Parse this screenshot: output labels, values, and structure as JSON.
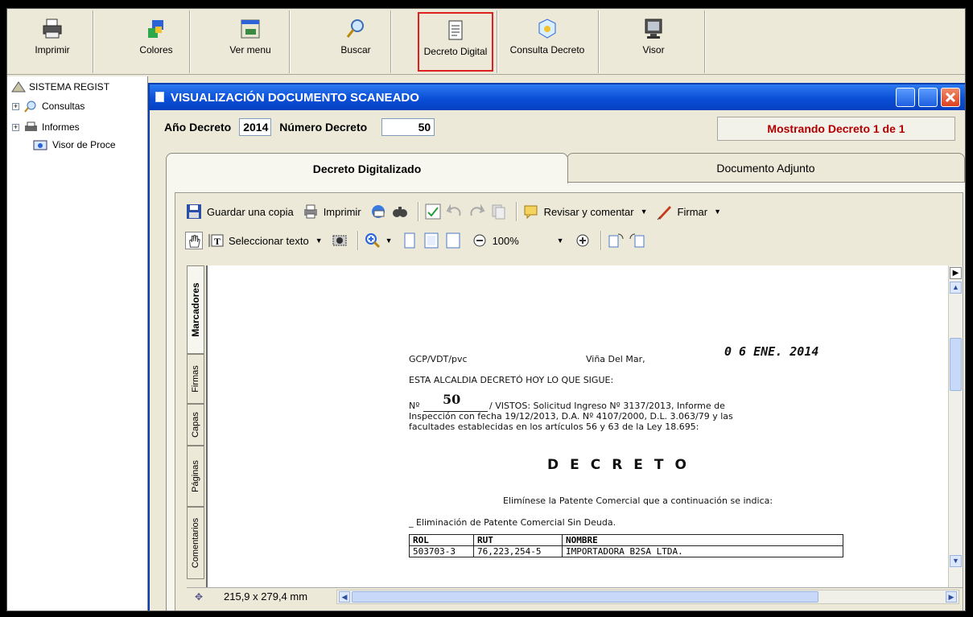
{
  "toolbar": {
    "items": [
      {
        "label": "Imprimir",
        "icon": "printer-icon"
      },
      {
        "label": "Colores",
        "icon": "colors-icon"
      },
      {
        "label": "Ver menu",
        "icon": "menu-icon"
      },
      {
        "label": "Buscar",
        "icon": "search-icon"
      },
      {
        "label": "Decreto Digital",
        "icon": "document-icon"
      },
      {
        "label": "Consulta Decreto",
        "icon": "query-icon"
      },
      {
        "label": "Visor",
        "icon": "monitor-icon"
      }
    ]
  },
  "tree": {
    "root": "SISTEMA REGIST",
    "items": [
      {
        "label": "Consultas",
        "expandable": true
      },
      {
        "label": "Informes",
        "expandable": true
      },
      {
        "label": "Visor de Proce",
        "expandable": false
      }
    ]
  },
  "dialog": {
    "title": "VISUALIZACIÓN DOCUMENTO SCANEADO",
    "year_label": "Año Decreto",
    "year_value": "2014",
    "number_label": "Número Decreto",
    "number_value": "50",
    "status": "Mostrando Decreto 1 de 1",
    "tabs": [
      "Decreto Digitalizado",
      "Documento Adjunto"
    ]
  },
  "reader": {
    "toolbar1": {
      "save_copy": "Guardar una copia",
      "print": "Imprimir",
      "review": "Revisar y comentar",
      "sign": "Firmar"
    },
    "toolbar2": {
      "select_text": "Seleccionar texto",
      "zoom": "100%"
    },
    "side_tabs": [
      "Marcadores",
      "Firmas",
      "Capas",
      "Páginas",
      "Comentarios"
    ],
    "page_size": "215,9 x 279,4 mm"
  },
  "document": {
    "ref": "GCP/VDT/pvc",
    "place": "Viña Del Mar,",
    "date": "0 6 ENE. 2014",
    "intro": "ESTA ALCALDIA DECRETÓ HOY LO QUE SIGUE:",
    "num_prefix": "Nº",
    "num": "50",
    "vistos_1": "/ VISTOS: Solicitud Ingreso Nº 3137/2013,  Informe de",
    "vistos_2": "Inspección con fecha 19/12/2013,    D.A. Nº 4107/2000,  D.L. 3.063/79 y  las",
    "vistos_3": "facultades  establecidas  en los artículos  56 y 63 de la Ley 18.695:",
    "heading": "DECRETO",
    "body_1": "Elimínese la Patente  Comercial  que a continuación se indica:",
    "body_2": "_ Eliminación de Patente Comercial Sin Deuda.",
    "table": {
      "headers": [
        "ROL",
        "RUT",
        "NOMBRE"
      ],
      "rows": [
        [
          "503703-3",
          "76,223,254-5",
          "IMPORTADORA B2SA LTDA."
        ]
      ]
    }
  }
}
